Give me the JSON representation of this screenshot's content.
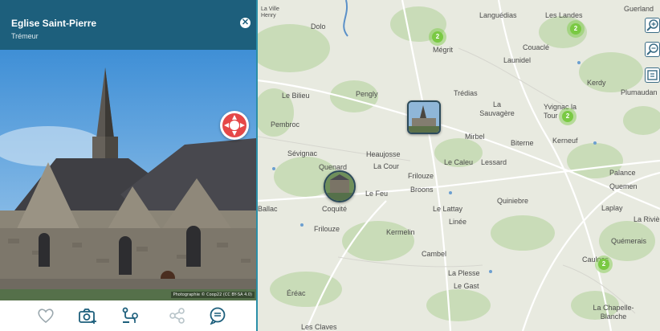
{
  "panel": {
    "title": "Eglise Saint-Pierre",
    "subtitle": "Trémeur",
    "photo_credit": "Photographie © Coop22 (CC BY-SA 4.0)"
  },
  "toolbar": {
    "buttons": [
      {
        "icon": "heart-icon"
      },
      {
        "icon": "camera-add-icon"
      },
      {
        "icon": "route-icon"
      },
      {
        "icon": "share-icon"
      },
      {
        "icon": "comment-icon"
      }
    ]
  },
  "map": {
    "places": [
      "La Ville Henry",
      "Dolo",
      "Languédias",
      "Les Landes",
      "Guerland",
      "Mégrit",
      "Couaclé",
      "Launidel",
      "Kerdy",
      "Plumaudan",
      "Le Bilieu",
      "Pengly",
      "Trédias",
      "La Sauvagère",
      "Yvignac la Tour",
      "Pembroc",
      "Mirbel",
      "Biterne",
      "Kerneuf",
      "Sévignac",
      "Quenard",
      "Heaujosse",
      "La Cour",
      "Frilouze",
      "Le Caleu",
      "Lessard",
      "Palance",
      "Quemen",
      "Le Feu",
      "Broons",
      "Coquité",
      "Le Lattay",
      "Linée",
      "Quiniebre",
      "Laplay",
      "La Rivière",
      "Ballac",
      "Frilouze",
      "Kermelin",
      "Quémerais",
      "Cambel",
      "La Plesse",
      "Le Gast",
      "Caulnes",
      "Éréac",
      "La Chapelle-Blanche",
      "Les Claves"
    ],
    "clusters": [
      "2",
      "2",
      "2",
      "2"
    ]
  }
}
